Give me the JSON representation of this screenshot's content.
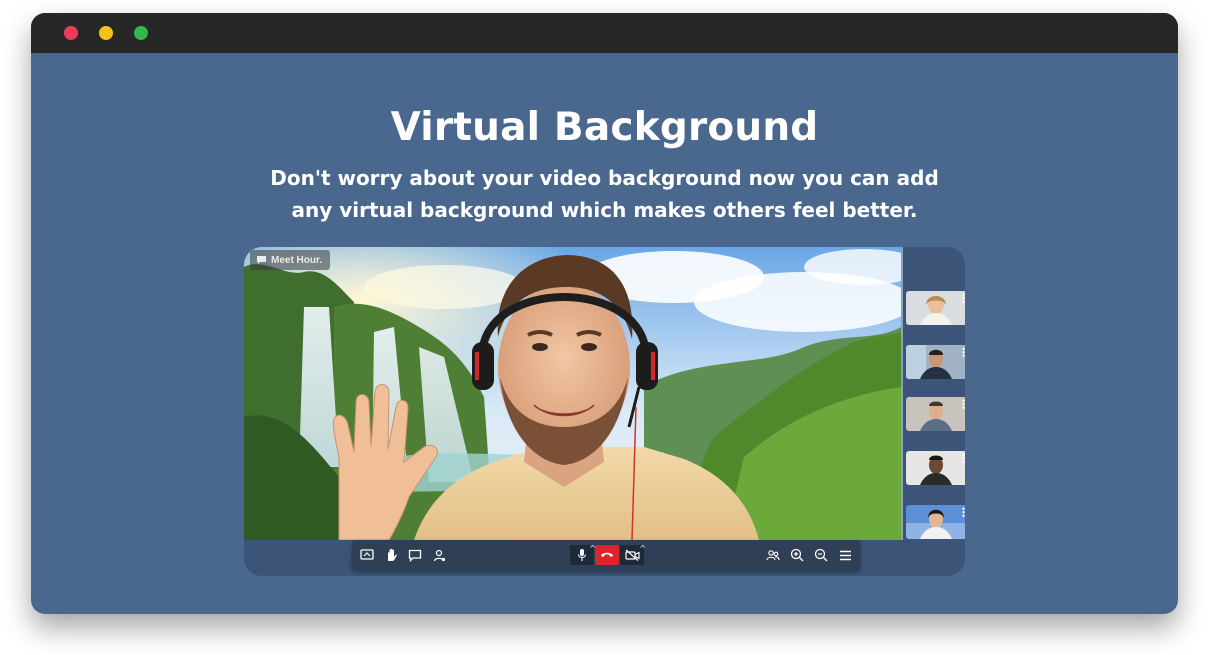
{
  "window": {
    "controls": [
      "close",
      "minimize",
      "maximize"
    ],
    "colors": {
      "close": "#ee3b5a",
      "minimize": "#f5c11c",
      "maximize": "#2fb84c",
      "titlebar": "#272727",
      "background": "#4a678e"
    }
  },
  "hero": {
    "title": "Virtual Background",
    "subtitle_line1": "Don't worry about your video background now you can add",
    "subtitle_line2": "any virtual background which makes others feel better."
  },
  "meeting": {
    "brand_label": "Meet Hour.",
    "participants": [
      "participant-1",
      "participant-2",
      "participant-3",
      "participant-4",
      "participant-5"
    ],
    "toolbar": {
      "left_icons": [
        "screen-share-icon",
        "raise-hand-icon",
        "chat-icon",
        "participants-icon"
      ],
      "center_icons": [
        "microphone-icon",
        "hangup-icon",
        "camera-off-icon"
      ],
      "right_icons": [
        "tile-view-icon",
        "zoom-in-icon",
        "zoom-out-icon",
        "more-menu-icon"
      ],
      "hangup_color": "#d9252b"
    }
  }
}
